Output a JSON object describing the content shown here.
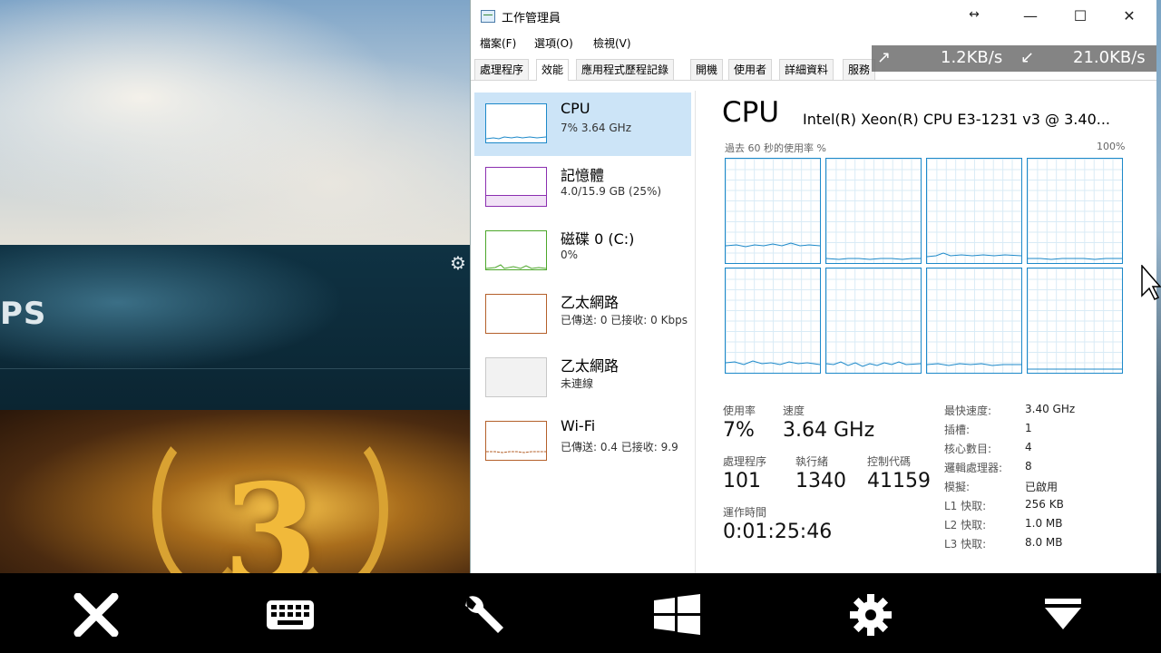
{
  "background": {
    "banner_text": "PS"
  },
  "window": {
    "title": "工作管理員",
    "menu": [
      "檔案(F)",
      "選項(O)",
      "檢視(V)"
    ],
    "tabs": [
      "處理程序",
      "效能",
      "應用程式歷程記錄",
      "開機",
      "使用者",
      "詳細資料",
      "服務"
    ],
    "active_tab": "效能"
  },
  "speed_overlay": {
    "upload": "1.2KB/s",
    "download": "21.0KB/s"
  },
  "sidebar": [
    {
      "name": "CPU",
      "sub": "7% 3.64 GHz",
      "color": "#1d89c9"
    },
    {
      "name": "記憶體",
      "sub": "4.0/15.9 GB (25%)",
      "color": "#8b2fb0"
    },
    {
      "name": "磁碟 0 (C:)",
      "sub": "0%",
      "color": "#4ca72a"
    },
    {
      "name": "乙太網路",
      "sub": "已傳送: 0 已接收: 0 Kbps",
      "color": "#b4602a"
    },
    {
      "name": "乙太網路",
      "sub": "未連線",
      "color": "#b0b0b0"
    },
    {
      "name": "Wi-Fi",
      "sub": "已傳送: 0.4 已接收: 9.9",
      "color": "#b4602a"
    }
  ],
  "cpu": {
    "title": "CPU",
    "model": "Intel(R) Xeon(R) CPU E3-1231 v3 @ 3.40...",
    "graph_label": "過去 60 秒的使用率 %",
    "graph_max": "100%",
    "core_count": 8,
    "stats": [
      {
        "label": "使用率",
        "value": "7%"
      },
      {
        "label": "速度",
        "value": "3.64 GHz"
      },
      {
        "label": "處理程序",
        "value": "101"
      },
      {
        "label": "執行緒",
        "value": "1340"
      },
      {
        "label": "控制代碼",
        "value": "41159"
      },
      {
        "label": "運作時間",
        "value": "0:01:25:46"
      }
    ],
    "specs": [
      {
        "label": "最快速度:",
        "value": "3.40 GHz"
      },
      {
        "label": "插槽:",
        "value": "1"
      },
      {
        "label": "核心數目:",
        "value": "4"
      },
      {
        "label": "邏輯處理器:",
        "value": "8"
      },
      {
        "label": "模擬:",
        "value": "已啟用"
      },
      {
        "label": "L1 快取:",
        "value": "256 KB"
      },
      {
        "label": "L2 快取:",
        "value": "1.0 MB"
      },
      {
        "label": "L3 快取:",
        "value": "8.0 MB"
      }
    ]
  },
  "colors": {
    "cpu_accent": "#1d89c9",
    "selected_bg": "#cce4f7"
  },
  "toolbar": [
    "close-icon",
    "keyboard-icon",
    "wrench-icon",
    "windows-icon",
    "gear-icon",
    "dropdown-icon"
  ]
}
